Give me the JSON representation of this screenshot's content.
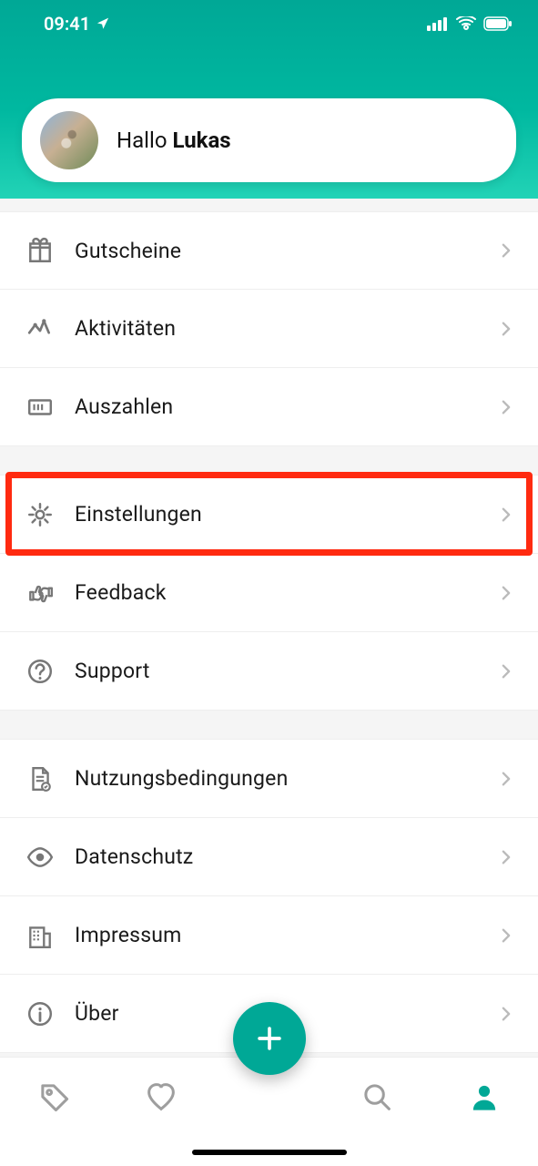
{
  "statusbar": {
    "time": "09:41"
  },
  "profile": {
    "greeting_prefix": "Hallo ",
    "name": "Lukas"
  },
  "menu": {
    "group1": [
      {
        "id": "vouchers",
        "label": "Gutscheine",
        "icon": "gift"
      },
      {
        "id": "activities",
        "label": "Aktivitäten",
        "icon": "activity"
      },
      {
        "id": "payouts",
        "label": "Auszahlen",
        "icon": "banknote"
      }
    ],
    "group2": [
      {
        "id": "settings",
        "label": "Einstellungen",
        "icon": "gear"
      },
      {
        "id": "feedback",
        "label": "Feedback",
        "icon": "thumbs"
      },
      {
        "id": "support",
        "label": "Support",
        "icon": "help"
      }
    ],
    "group3": [
      {
        "id": "terms",
        "label": "Nutzungsbedingungen",
        "icon": "document"
      },
      {
        "id": "privacy",
        "label": "Datenschutz",
        "icon": "eye"
      },
      {
        "id": "imprint",
        "label": "Impressum",
        "icon": "building"
      },
      {
        "id": "about",
        "label": "Über",
        "icon": "info"
      }
    ]
  },
  "highlighted_row_id": "settings",
  "tabs": [
    {
      "id": "offers",
      "icon": "tag"
    },
    {
      "id": "likes",
      "icon": "heart"
    },
    {
      "id": "add",
      "icon": "plus"
    },
    {
      "id": "search",
      "icon": "search"
    },
    {
      "id": "profile",
      "icon": "person",
      "active": true
    }
  ]
}
